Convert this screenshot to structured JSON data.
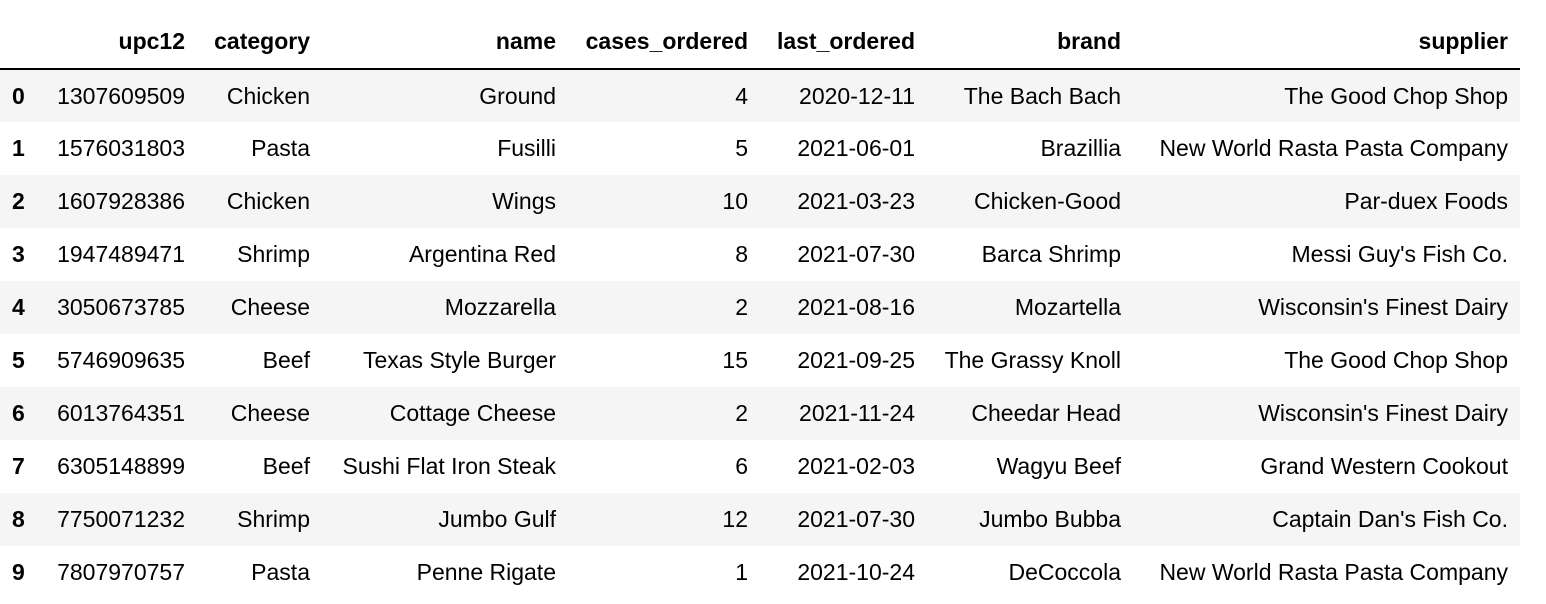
{
  "columns": [
    "",
    "upc12",
    "category",
    "name",
    "cases_ordered",
    "last_ordered",
    "brand",
    "supplier"
  ],
  "rows": [
    {
      "index": "0",
      "upc12": "1307609509",
      "category": "Chicken",
      "name": "Ground",
      "cases_ordered": "4",
      "last_ordered": "2020-12-11",
      "brand": "The Bach Bach",
      "supplier": "The Good Chop Shop"
    },
    {
      "index": "1",
      "upc12": "1576031803",
      "category": "Pasta",
      "name": "Fusilli",
      "cases_ordered": "5",
      "last_ordered": "2021-06-01",
      "brand": "Brazillia",
      "supplier": "New World Rasta Pasta Company"
    },
    {
      "index": "2",
      "upc12": "1607928386",
      "category": "Chicken",
      "name": "Wings",
      "cases_ordered": "10",
      "last_ordered": "2021-03-23",
      "brand": "Chicken-Good",
      "supplier": "Par-duex Foods"
    },
    {
      "index": "3",
      "upc12": "1947489471",
      "category": "Shrimp",
      "name": "Argentina Red",
      "cases_ordered": "8",
      "last_ordered": "2021-07-30",
      "brand": "Barca Shrimp",
      "supplier": "Messi Guy's Fish Co."
    },
    {
      "index": "4",
      "upc12": "3050673785",
      "category": "Cheese",
      "name": "Mozzarella",
      "cases_ordered": "2",
      "last_ordered": "2021-08-16",
      "brand": "Mozartella",
      "supplier": "Wisconsin's Finest Dairy"
    },
    {
      "index": "5",
      "upc12": "5746909635",
      "category": "Beef",
      "name": "Texas Style Burger",
      "cases_ordered": "15",
      "last_ordered": "2021-09-25",
      "brand": "The Grassy Knoll",
      "supplier": "The Good Chop Shop"
    },
    {
      "index": "6",
      "upc12": "6013764351",
      "category": "Cheese",
      "name": "Cottage Cheese",
      "cases_ordered": "2",
      "last_ordered": "2021-11-24",
      "brand": "Cheedar Head",
      "supplier": "Wisconsin's Finest Dairy"
    },
    {
      "index": "7",
      "upc12": "6305148899",
      "category": "Beef",
      "name": "Sushi Flat Iron Steak",
      "cases_ordered": "6",
      "last_ordered": "2021-02-03",
      "brand": "Wagyu Beef",
      "supplier": "Grand Western Cookout"
    },
    {
      "index": "8",
      "upc12": "7750071232",
      "category": "Shrimp",
      "name": "Jumbo Gulf",
      "cases_ordered": "12",
      "last_ordered": "2021-07-30",
      "brand": "Jumbo Bubba",
      "supplier": "Captain Dan's Fish Co."
    },
    {
      "index": "9",
      "upc12": "7807970757",
      "category": "Pasta",
      "name": "Penne Rigate",
      "cases_ordered": "1",
      "last_ordered": "2021-10-24",
      "brand": "DeCoccola",
      "supplier": "New World Rasta Pasta Company"
    }
  ],
  "colors": {
    "stripe": "#f5f5f5",
    "background": "#ffffff",
    "text": "#000000",
    "header_rule": "#000000"
  }
}
